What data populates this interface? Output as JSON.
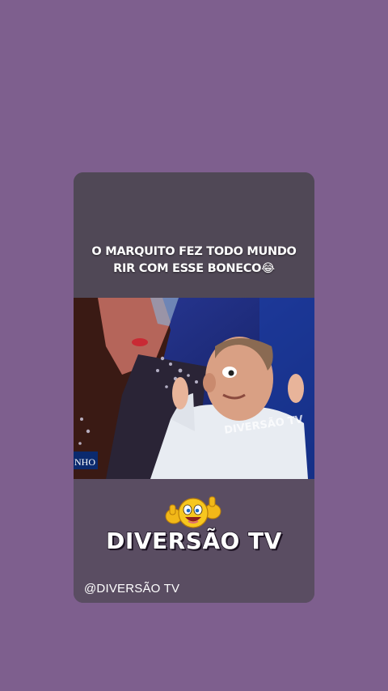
{
  "story": {
    "caption_line1": "O MARQUITO FEZ TODO MUNDO",
    "caption_line2": "RIR COM ESSE BONECO😂",
    "video_watermark": "DIVERSÃO TV",
    "video_corner_text": "NHO",
    "brand_title": "DIVERSÃO TV",
    "handle": "@DIVERSÃO TV",
    "emoji_icon": "thumbs-up-smiley"
  },
  "colors": {
    "background": "#7e5f8e",
    "card": "#584f61",
    "text": "#ffffff"
  }
}
